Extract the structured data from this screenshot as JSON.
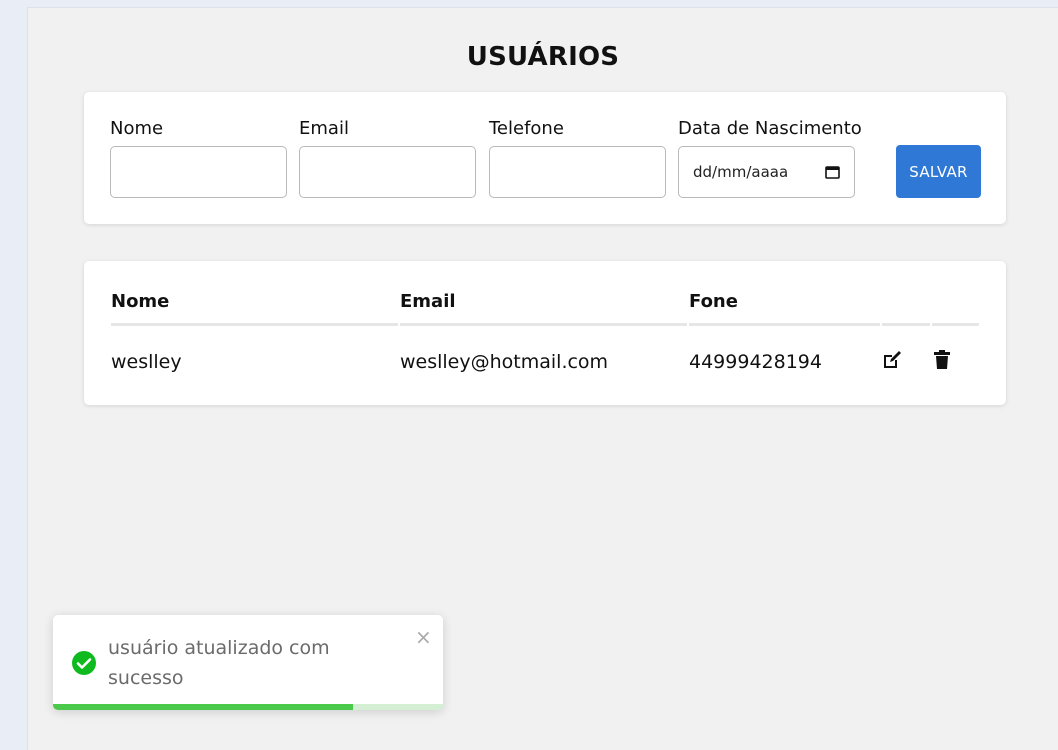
{
  "page": {
    "title": "USUÁRIOS"
  },
  "form": {
    "fields": [
      {
        "label": "Nome",
        "value": ""
      },
      {
        "label": "Email",
        "value": ""
      },
      {
        "label": "Telefone",
        "value": ""
      },
      {
        "label": "Data de Nascimento",
        "placeholder": "dd/mm/aaaa"
      }
    ],
    "save_label": "SALVAR"
  },
  "table": {
    "headers": [
      "Nome",
      "Email",
      "Fone"
    ],
    "rows": [
      {
        "nome": "weslley",
        "email": "weslley@hotmail.com",
        "fone": "44999428194",
        "actions": [
          "edit-icon",
          "trash-icon"
        ]
      }
    ]
  },
  "toast": {
    "message": "usuário atualizado com sucesso",
    "close": "×",
    "icon": "check-circle-icon",
    "progress": 0.77,
    "colors": {
      "success": "#4bc94b",
      "track": "#d4efd4"
    }
  },
  "colors": {
    "accent": "#2f78d6",
    "panel": "#f1f1f1"
  }
}
